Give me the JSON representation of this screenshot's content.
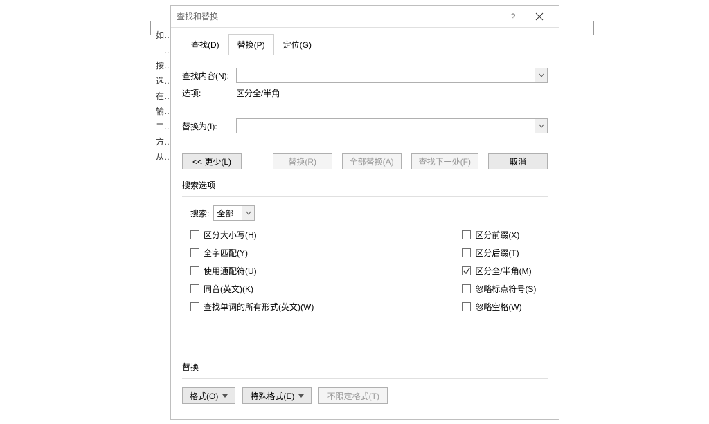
{
  "background_doc": {
    "lines": [
      "如………",
      "一………",
      "按………从中",
      "选………",
      "在………自动",
      "输………",
      "二………",
      "方………单，",
      "从………可。"
    ]
  },
  "dialog": {
    "title": "查找和替换",
    "help": "?",
    "tabs": {
      "find": "查找(D)",
      "replace": "替换(P)",
      "goto": "定位(G)"
    },
    "find_label": "查找内容(N):",
    "options_label": "选项:",
    "options_value": "区分全/半角",
    "replace_label": "替换为(I):",
    "buttons": {
      "less": "<< 更少(L)",
      "replace_one": "替换(R)",
      "replace_all": "全部替换(A)",
      "find_next": "查找下一处(F)",
      "cancel": "取消"
    },
    "search_options_title": "搜索选项",
    "search_label": "搜索:",
    "search_scope": "全部",
    "checks_left": [
      "区分大小写(H)",
      "全字匹配(Y)",
      "使用通配符(U)",
      "同音(英文)(K)",
      "查找单词的所有形式(英文)(W)"
    ],
    "checks_right": [
      "区分前缀(X)",
      "区分后缀(T)",
      "区分全/半角(M)",
      "忽略标点符号(S)",
      "忽略空格(W)"
    ],
    "replace_section_title": "替换",
    "format_btn": "格式(O)",
    "special_btn": "特殊格式(E)",
    "noformat_btn": "不限定格式(T)"
  }
}
